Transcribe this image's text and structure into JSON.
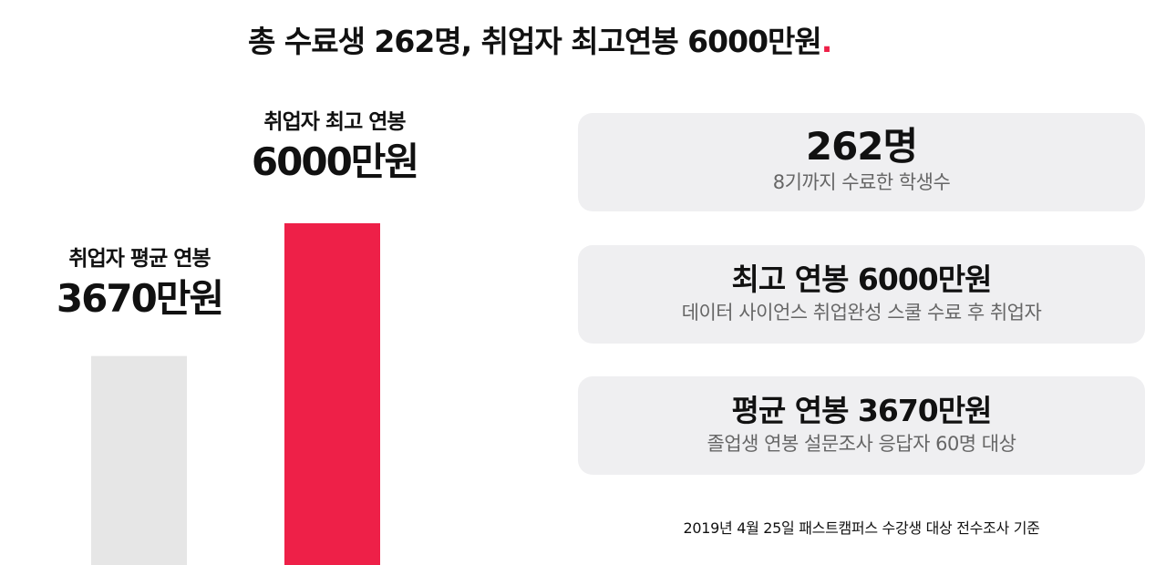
{
  "headline": {
    "text": "총 수료생 262명, 취업자 최고연봉 6000만원",
    "dot": "."
  },
  "chart_data": {
    "type": "bar",
    "title": "",
    "xlabel": "",
    "ylabel": "",
    "ylim": [
      0,
      6000
    ],
    "categories": [
      "취업자 평균 연봉",
      "취업자 최고 연봉"
    ],
    "values": [
      3670,
      6000
    ],
    "value_labels": [
      "3670만원",
      "6000만원"
    ],
    "unit": "만원",
    "bar_colors": [
      "#e6e6e6",
      "#ee2048"
    ],
    "grid": false,
    "legend": "none"
  },
  "cards": [
    {
      "title": "262명",
      "subtitle": "8기까지 수료한 학생수"
    },
    {
      "title": "최고 연봉 6000만원",
      "subtitle": "데이터 사이언스 취업완성 스쿨 수료 후 취업자"
    },
    {
      "title": "평균 연봉 3670만원",
      "subtitle": "졸업생 연봉 설문조사 응답자 60명 대상"
    }
  ],
  "footnote": "2019년 4월 25일 패스트캠퍼스 수강생 대상 전수조사 기준",
  "colors": {
    "accent": "#ee2048",
    "bar_avg": "#e6e6e6",
    "card_bg": "#efeff1",
    "subtext": "#666666"
  }
}
